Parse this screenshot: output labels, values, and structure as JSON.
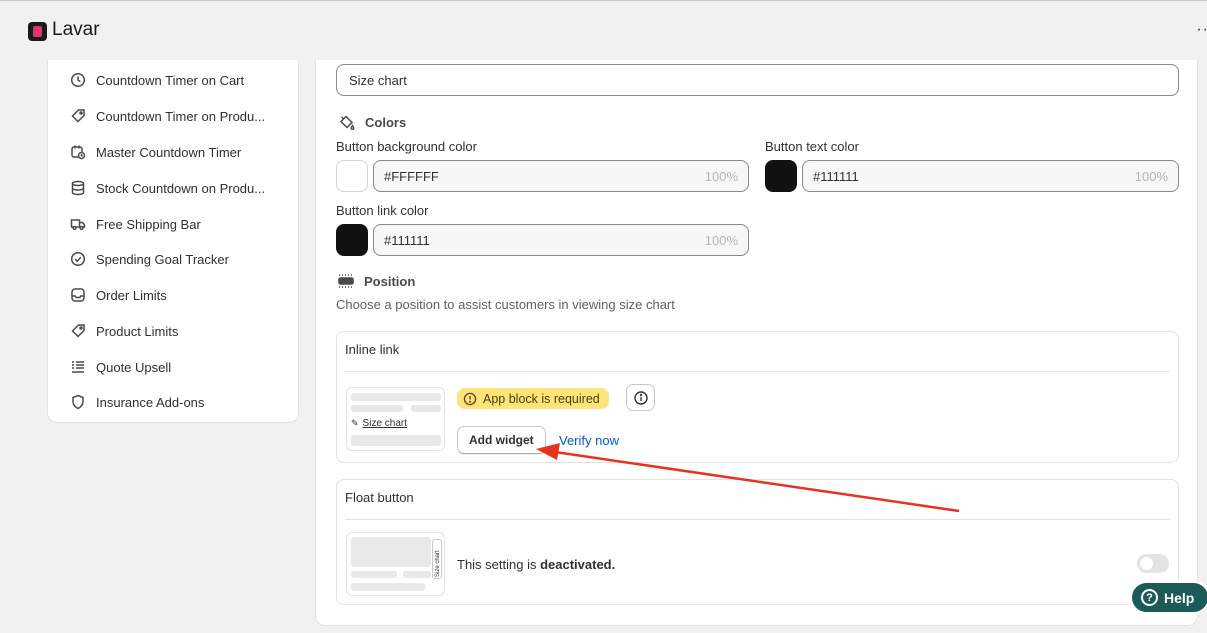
{
  "app": {
    "title": "Lavar",
    "more": "··"
  },
  "sidebar": {
    "items": [
      {
        "label": "Countdown Timer on Cart",
        "icon": "clock-icon"
      },
      {
        "label": "Countdown Timer on Produ...",
        "icon": "tag-refresh-icon"
      },
      {
        "label": "Master Countdown Timer",
        "icon": "calendar-clock-icon"
      },
      {
        "label": "Stock Countdown on Produ...",
        "icon": "database-icon"
      },
      {
        "label": "Free Shipping Bar",
        "icon": "truck-icon"
      },
      {
        "label": "Spending Goal Tracker",
        "icon": "check-circle-icon"
      },
      {
        "label": "Order Limits",
        "icon": "inbox-icon"
      },
      {
        "label": "Product Limits",
        "icon": "tag-icon"
      },
      {
        "label": "Quote Upsell",
        "icon": "list-icon"
      },
      {
        "label": "Insurance Add-ons",
        "icon": "shield-icon"
      }
    ]
  },
  "main": {
    "text_value": "Size chart",
    "colors": {
      "heading": "Colors",
      "bg_label": "Button background color",
      "bg_value": "#FFFFFF",
      "bg_swatch": "#FFFFFF",
      "text_label": "Button text color",
      "text_value": "#111111",
      "text_swatch": "#111111",
      "link_label": "Button link color",
      "link_value": "#111111",
      "link_swatch": "#111111",
      "opacity": "100%"
    },
    "position": {
      "heading": "Position",
      "hint": "Choose a position to assist customers in viewing size chart",
      "inline": {
        "title": "Inline link",
        "thumb_link": "Size chart",
        "badge": "App block is required",
        "add_widget": "Add widget",
        "verify": "Verify now"
      },
      "float": {
        "title": "Float button",
        "thumb_tab": "Size chart",
        "status_prefix": "This setting is ",
        "status_value": "deactivated."
      }
    }
  },
  "help": {
    "label": "Help"
  },
  "accent": {
    "annotation_arrow": "#e8321e",
    "link": "#005bd3",
    "badge": "#ffe47a",
    "help_button": "#1c5a58"
  }
}
